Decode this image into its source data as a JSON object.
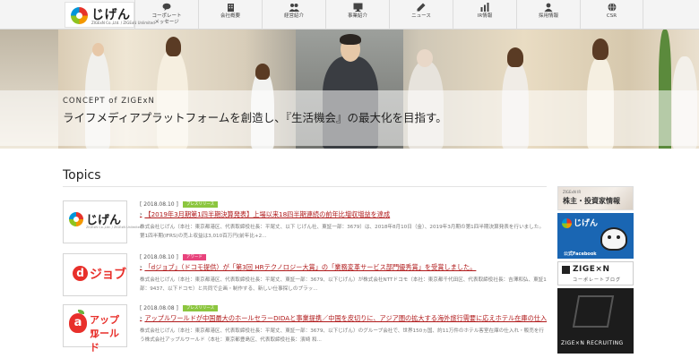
{
  "header": {
    "logo": {
      "text": "じげん",
      "subtext": "ZIGExN Co.,Ltd. / ZIGExN Unlimited"
    },
    "nav": [
      {
        "label": "コーポレート\nメッセージ",
        "icon": "speech-bubble-icon"
      },
      {
        "label": "会社概要",
        "icon": "building-icon"
      },
      {
        "label": "経営紹介",
        "icon": "people-icon"
      },
      {
        "label": "事業紹介",
        "icon": "monitor-icon"
      },
      {
        "label": "ニュース",
        "icon": "pen-icon"
      },
      {
        "label": "IR情報",
        "icon": "chart-icon"
      },
      {
        "label": "採用情報",
        "icon": "person-icon"
      },
      {
        "label": "CSR",
        "icon": "globe-icon"
      }
    ]
  },
  "hero": {
    "concept": "CONCEPT of ZIGExN",
    "tagline": "ライフメディアプラットフォームを創造し、『生活機会』の最大化を目指す。"
  },
  "topics": {
    "title": "Topics",
    "items": [
      {
        "logo": "jigen",
        "date": "[ 2018.08.10 ]",
        "tag": "プレスリリース",
        "tag_color": "#8cc63f",
        "headline": "【2019年3月期第1四半期決算発表】上場以来18四半期連続の前年比増収増益を達成",
        "text": "株式会社じげん（本社：東京都港区、代表取締役社長：平尾丈、以下 じげん社、東証一部：3679）は、2018年8月10日（金）、2019年3月期の第1四半期決算発表を行いました。第1四半期(IFRS)の売上収益は3,010百万円(前年比+2..."
      },
      {
        "logo": "djob",
        "date": "[ 2018.08.10 ]",
        "tag": "アワード",
        "tag_color": "#e8437c",
        "headline": "「dジョブ」（ドコモ提供）が「第3回 HRテクノロジー大賞」の「業務変革サービス部門優秀賞」を受賞しました。",
        "text": "株式会社じげん（本社：東京都港区、代表取締役社長：平尾丈、東証一部：3679、以下じげん）が株式会社NTTドコモ（本社：東京都千代田区、代表取締役社長：吉澤和弘、東証1部：9437、以下ドコモ）と共同で企画・制作する、新しい仕事探しのプラッ..."
      },
      {
        "logo": "appleworld",
        "date": "[ 2018.08.08 ]",
        "tag": "プレスリリース",
        "tag_color": "#8cc63f",
        "headline": "アップルワールドが中国最大のホールセラーDIDAと事業提携／中国を皮切りに、アジア圏の拡大する海外旅行需要に応えホテル在庫の仕入れ・販売体制を強化",
        "text": "株式会社じげん（本社：東京都港区、代表取締役社長：平尾丈、東証一部：3679、以下じげん）のグループ会社で、世界150ヵ国、約11万件のホテル客室在庫の仕入れ・販売を行う株式会社アップルワールド（本社：東京都豊島区、代表取締役社長：濱崎 和..."
      }
    ],
    "logos": {
      "jigen": {
        "text": "じげん",
        "subtext": "ZIGExN Co.,Ltd. / ZIGExN Unlimited"
      },
      "djob": {
        "text": "ジョブ",
        "mark": "d"
      },
      "appleworld": {
        "line1": "アップル",
        "line2": "ワールド",
        "mark": "a"
      }
    }
  },
  "banners": {
    "ir": {
      "small": "ZIGExN IR",
      "main": "株主・投資家情報"
    },
    "facebook": {
      "logo": "じげん",
      "label": "公式Facebook"
    },
    "blog": {
      "main": "ZIGE×N",
      "sub": "コーポレートブログ"
    },
    "recruiting": {
      "text": "ZIGE×N RECRUITING"
    }
  },
  "colors": {
    "accent_red": "#b0191a",
    "djob_red": "#e8302b",
    "facebook_blue": "#1a66b3"
  }
}
